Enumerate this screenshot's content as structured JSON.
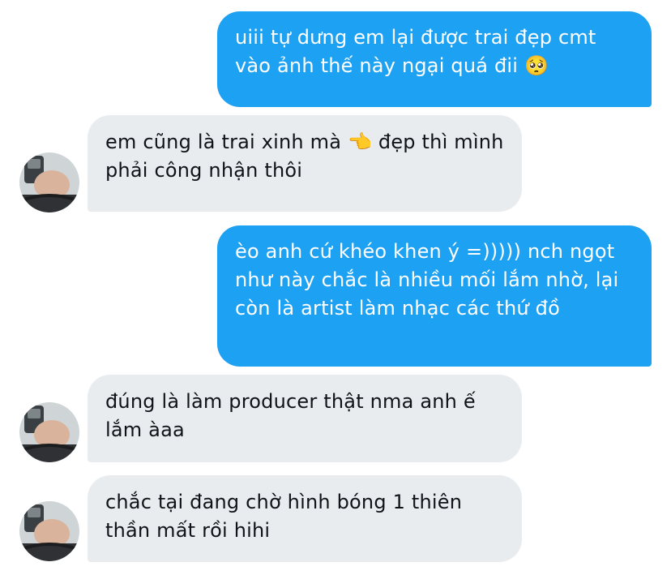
{
  "conversation": {
    "messages": [
      {
        "direction": "sent",
        "text": "uiii tự dưng em lại được trai đẹp cmt vào ảnh thế này ngại quá đii 🥺"
      },
      {
        "direction": "received",
        "text": "em cũng là trai xinh mà 👈 đẹp thì mình phải công nhận thôi"
      },
      {
        "direction": "sent",
        "text": "èo anh cứ khéo khen ý =))))) nch ngọt như này chắc là nhiều mối lắm nhờ, lại còn là artist làm nhạc các thứ đồ"
      },
      {
        "direction": "received",
        "text": "đúng là làm producer thật nma anh ế lắm àaa"
      },
      {
        "direction": "received",
        "text": "chắc tại đang chờ hình bóng 1 thiên thần mất rồi hihi"
      }
    ]
  },
  "colors": {
    "sent_bubble": "#1da1f2",
    "received_bubble": "#e9ecef",
    "sent_text": "#ffffff",
    "received_text": "#0f1419"
  }
}
